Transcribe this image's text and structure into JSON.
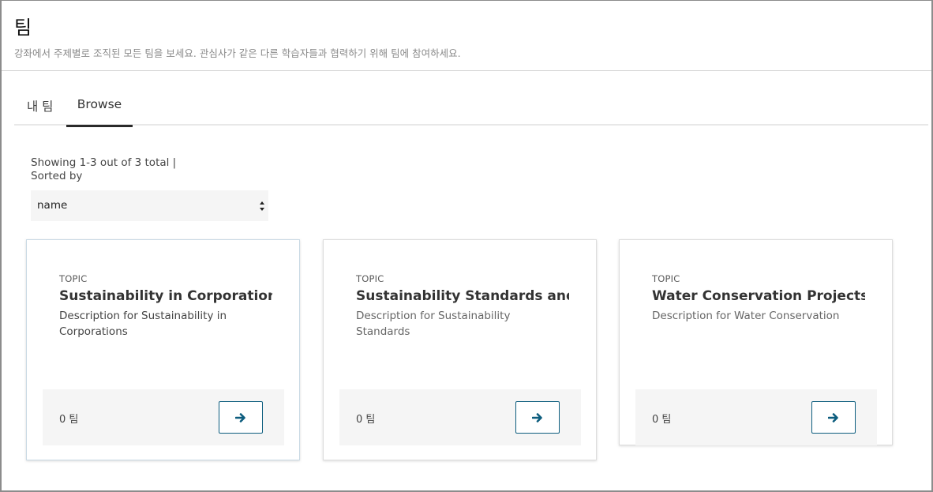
{
  "header": {
    "title": "팀",
    "description": "강좌에서 주제별로 조직된 모든 팀을 보세요. 관심사가 같은 다른 학습자들과 협력하기 위해 팀에 참여하세요."
  },
  "tabs": [
    {
      "label": "내 팀",
      "active": false
    },
    {
      "label": "Browse",
      "active": true
    }
  ],
  "listing": {
    "showing_text": "Showing 1-3 out of 3 total |",
    "sorted_by_text": "Sorted by",
    "sort_value": "name"
  },
  "cards": [
    {
      "type": "TOPIC",
      "title": "Sustainability in Corporations",
      "description": "Description for Sustainability in Corporations",
      "team_count": "0 팀",
      "action_icon": "arrow-right-icon"
    },
    {
      "type": "TOPIC",
      "title": "Sustainability Standards and...",
      "description": "Description for Sustainability Standards",
      "team_count": "0 팀",
      "action_icon": "arrow-right-icon"
    },
    {
      "type": "TOPIC",
      "title": "Water Conservation Projects",
      "description": "Description for Water Conservation",
      "team_count": "0 팀",
      "action_icon": "arrow-right-icon"
    }
  ],
  "colors": {
    "accent": "#0d5d7e",
    "footer_bg": "#f5f5f5",
    "active_tab": "#2a2a2a"
  }
}
